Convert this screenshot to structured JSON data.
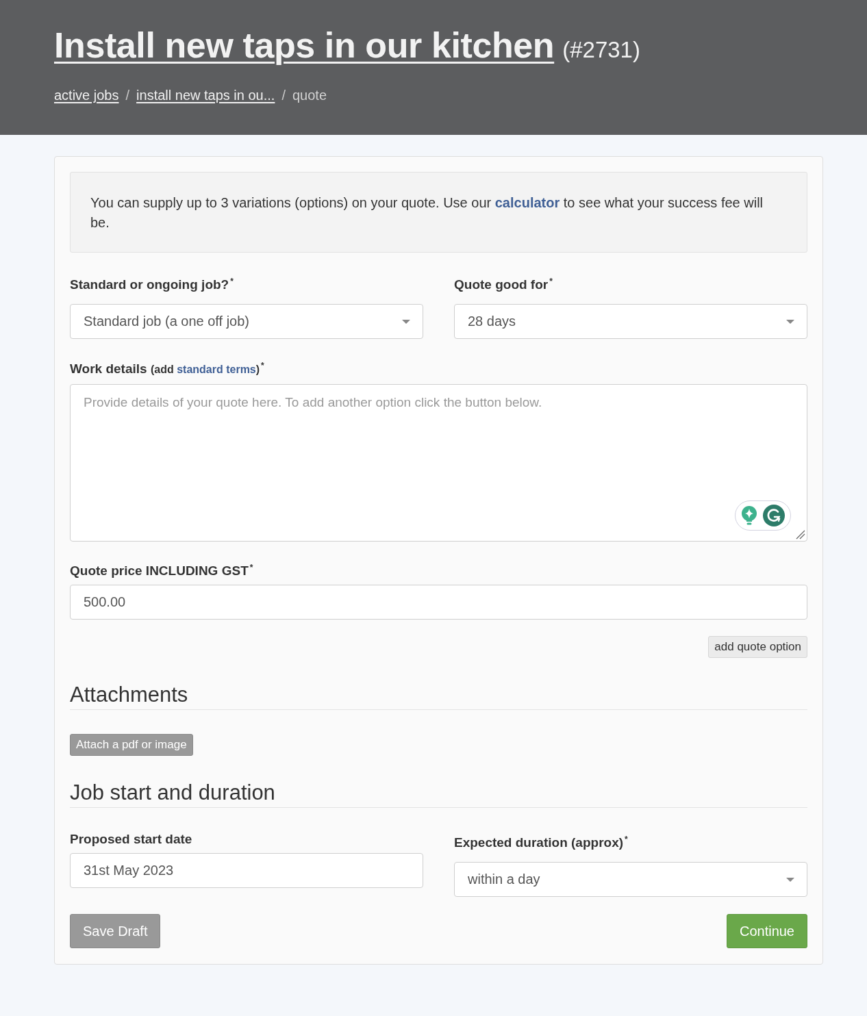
{
  "header": {
    "title": "Install new taps in our kitchen",
    "job_number": "(#2731)",
    "breadcrumbs": [
      {
        "label": "active jobs",
        "kind": "link"
      },
      {
        "label": "install new taps in ou...",
        "kind": "link",
        "separator": "/"
      },
      {
        "label": "quote",
        "kind": "current",
        "separator": "/"
      }
    ]
  },
  "notice": {
    "text_before": "You can supply up to 3 variations (options) on your quote. Use our",
    "link": "calculator",
    "text_after": "to see what your success fee will be."
  },
  "quote_fields": [
    {
      "kind": "select",
      "label": "Standard or ongoing job?",
      "required_mark": "*",
      "value": "Standard job (a one off job)"
    },
    {
      "kind": "select",
      "label": "Quote good for",
      "required_mark": "*",
      "value": "28 days"
    }
  ],
  "work_details": {
    "label": "Work details",
    "note_open": "(add",
    "note_link": "standard terms",
    "note_close": ")",
    "required_mark": "*",
    "placeholder": "Provide details of your quote here. To add another option click the button below."
  },
  "price": {
    "label": "Quote price INCLUDING GST",
    "required_mark": "*",
    "value": "500.00"
  },
  "add_option_button": "add quote option",
  "attachments": {
    "heading": "Attachments",
    "button": "Attach a pdf or image"
  },
  "schedule": {
    "heading": "Job start and duration",
    "fields": [
      {
        "kind": "text",
        "label": "Proposed start date",
        "value": "31st May 2023"
      },
      {
        "kind": "select",
        "label": "Expected duration (approx)",
        "required_mark": "*",
        "value": "within a day"
      }
    ]
  },
  "actions": [
    {
      "label": "Save Draft",
      "kind": "secondary"
    },
    {
      "label": "Continue",
      "kind": "primary"
    }
  ]
}
